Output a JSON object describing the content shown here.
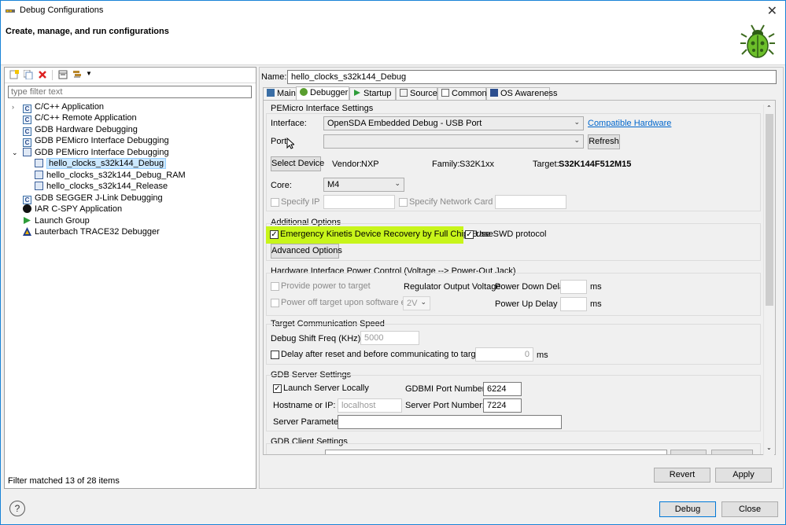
{
  "window": {
    "title": "Debug Configurations",
    "close_glyph": "✕"
  },
  "header": {
    "title": "Create, manage, and run configurations"
  },
  "left": {
    "filter_placeholder": "type filter text",
    "tree": [
      {
        "label": "C/C++ Application",
        "icon": "c-app-icon"
      },
      {
        "label": "C/C++ Remote Application",
        "icon": "c-remote-icon"
      },
      {
        "label": "GDB Hardware Debugging",
        "icon": "c-gdb-icon"
      },
      {
        "label": "GDB PEMicro Interface Debugging",
        "icon": "pemicro-icon"
      },
      {
        "label": "hello_clocks_s32k144_Debug",
        "icon": "config-icon"
      },
      {
        "label": "hello_clocks_s32k144_Debug_RAM",
        "icon": "config-icon"
      },
      {
        "label": "hello_clocks_s32k144_Release",
        "icon": "config-icon"
      },
      {
        "label": "GDB SEGGER J-Link Debugging",
        "icon": "segger-icon"
      },
      {
        "label": "IAR C-SPY Application",
        "icon": "iar-icon"
      },
      {
        "label": "Launch Group",
        "icon": "launch-icon"
      },
      {
        "label": "Lauterbach TRACE32 Debugger",
        "icon": "trace32-icon"
      }
    ],
    "status": "Filter matched 13 of 28 items"
  },
  "right": {
    "name_label": "Name:",
    "name_value": "hello_clocks_s32k144_Debug",
    "tabs": [
      "Main",
      "Debugger",
      "Startup",
      "Source",
      "Common",
      "OS Awareness"
    ],
    "pemicro": {
      "group": "PEMicro Interface Settings",
      "interface_label": "Interface:",
      "interface_value": "OpenSDA Embedded Debug - USB Port",
      "compatible_link": "Compatible Hardware",
      "port_label": "Port:",
      "port_value": "",
      "refresh": "Refresh",
      "select_device": "Select Device",
      "vendor_label": "Vendor:",
      "vendor_value": "NXP",
      "family_label": "Family:",
      "family_value": "S32K1xx",
      "target_label": "Target:",
      "target_value": "S32K144F512M15",
      "core_label": "Core:",
      "core_value": "M4",
      "specify_ip": "Specify IP",
      "specify_nic": "Specify Network Card IP"
    },
    "additional": {
      "group": "Additional Options",
      "emergency": "Emergency Kinetis Device Recovery by Full Chip Erase",
      "swd": "Use SWD protocol",
      "advanced": "Advanced Options"
    },
    "power": {
      "group": "Hardware Interface Power Control (Voltage --> Power-Out Jack)",
      "provide": "Provide power to target",
      "regulator": "Regulator Output Voltage",
      "power_down": "Power Down Delay",
      "ms1": "ms",
      "power_off": "Power off target upon software exit",
      "voltage": "2V",
      "power_up": "Power Up Delay",
      "ms2": "ms"
    },
    "comm": {
      "group": "Target Communication Speed",
      "shift_label": "Debug Shift Freq (KHz)",
      "shift_value": "5000",
      "delay_label": "Delay after reset and before communicating to target for",
      "delay_value": "0",
      "ms": "ms"
    },
    "gdb_server": {
      "group": "GDB Server Settings",
      "launch": "Launch Server Locally",
      "gdbmi_label": "GDBMI Port Number:",
      "gdbmi_value": "6224",
      "host_label": "Hostname or IP:",
      "host_value": "localhost",
      "server_port_label": "Server Port Number:",
      "server_port_value": "7224",
      "params_label": "Server Parameters:",
      "params_value": ""
    },
    "gdb_client": {
      "group": "GDB Client Settings"
    },
    "revert": "Revert",
    "apply": "Apply"
  },
  "footer": {
    "help": "?",
    "debug": "Debug",
    "close": "Close"
  },
  "colors": {
    "highlight": "#c8f51a",
    "selection": "#cce8ff",
    "link": "#0066cc"
  }
}
